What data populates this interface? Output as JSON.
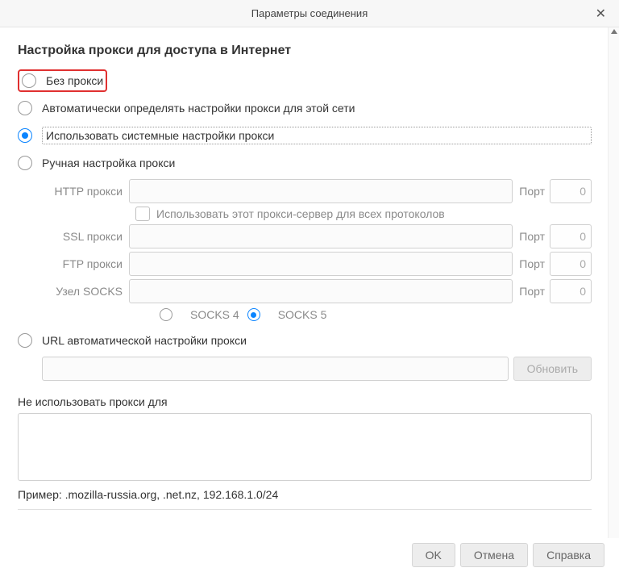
{
  "window": {
    "title": "Параметры соединения"
  },
  "section_title": "Настройка прокси для доступа в Интернет",
  "radios": {
    "no_proxy": "Без прокси",
    "auto_detect": "Автоматически определять настройки прокси для этой сети",
    "system": "Использовать системные настройки прокси",
    "manual": "Ручная настройка прокси",
    "auto_url": "URL автоматической настройки прокси"
  },
  "fields": {
    "http_label": "HTTP прокси",
    "ssl_label": "SSL прокси",
    "ftp_label": "FTP прокси",
    "socks_label": "Узел SOCKS",
    "port_label": "Порт",
    "port_value": "0",
    "share_checkbox": "Использовать этот прокси-сервер для всех протоколов",
    "socks4": "SOCKS 4",
    "socks5": "SOCKS 5"
  },
  "reload_btn": "Обновить",
  "no_proxy_for_label": "Не использовать прокси для",
  "example": "Пример: .mozilla-russia.org, .net.nz, 192.168.1.0/24",
  "buttons": {
    "ok": "OK",
    "cancel": "Отмена",
    "help": "Справка"
  }
}
